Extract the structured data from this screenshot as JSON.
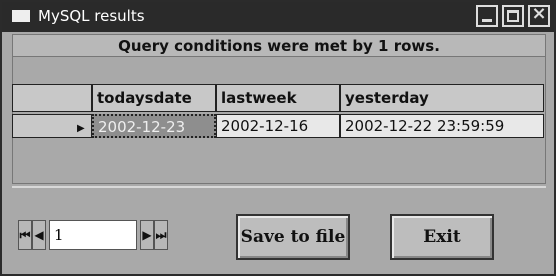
{
  "window": {
    "title": "MySQL results",
    "title_icon": "window-icon"
  },
  "caption": "Query conditions were met by 1 rows.",
  "table": {
    "columns": [
      "todaysdate",
      "lastweek",
      "yesterday"
    ],
    "rows": [
      [
        "2002-12-23",
        "2002-12-16",
        "2002-12-22 23:59:59"
      ]
    ]
  },
  "navigator": {
    "record": "1"
  },
  "buttons": {
    "save": "Save to file",
    "exit": "Exit"
  }
}
